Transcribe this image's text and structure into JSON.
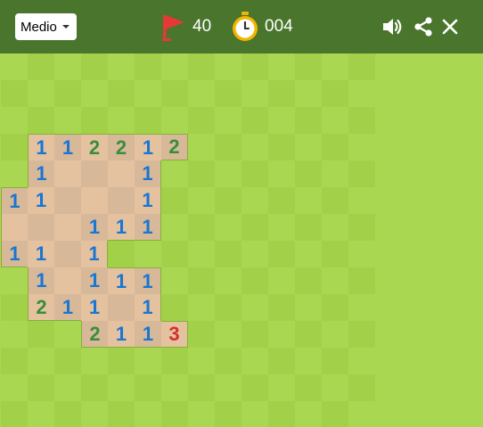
{
  "header": {
    "difficulty_label": "Medio",
    "flags": "40",
    "timer": "004"
  },
  "board": {
    "rows": [
      "##############",
      "##############",
      "##############",
      "#112212#######",
      "#1...1########",
      "11...1########",
      "...111########",
      "11.1##########",
      "#1.111########",
      "#211.1########",
      "###2113#######",
      "##############",
      "##############",
      "##############"
    ]
  },
  "colors": {
    "header_bg": "#4a752c",
    "grass_light": "#aad751",
    "grass_dark": "#a2d149",
    "dirt_light": "#e5c29f",
    "dirt_dark": "#d7b899",
    "num_1": "#1976d2",
    "num_2": "#388e3c",
    "num_3": "#d32f2f",
    "flag_red": "#e53935",
    "timer_gold": "#f4b400"
  },
  "icons": {
    "dropdown": "chevron-down-icon",
    "flag": "flag-icon",
    "timer": "stopwatch-icon",
    "sound": "speaker-icon",
    "share": "share-icon",
    "close": "close-icon"
  }
}
